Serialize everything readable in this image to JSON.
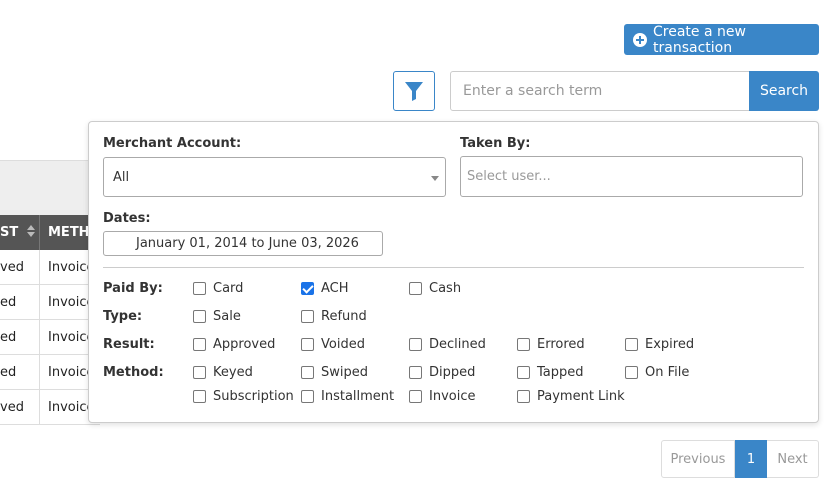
{
  "header": {
    "create_label": "Create a new transaction",
    "search_placeholder": "Enter a search term",
    "search_label": "Search"
  },
  "table": {
    "columns": [
      "ST",
      "METHO"
    ],
    "rows": [
      [
        "ved",
        "Invoice"
      ],
      [
        "ed",
        "Invoice"
      ],
      [
        "ed",
        "Invoice"
      ],
      [
        "ed",
        "Invoice"
      ],
      [
        "ved",
        "Invoice"
      ]
    ]
  },
  "filters": {
    "merchant_label": "Merchant Account:",
    "merchant_value": "All",
    "taken_by_label": "Taken By:",
    "taken_by_placeholder": "Select user...",
    "dates_label": "Dates:",
    "dates_value": "January 01, 2014 to June 03, 2026",
    "paid_by": {
      "label": "Paid By:",
      "options": [
        {
          "label": "Card",
          "checked": false
        },
        {
          "label": "ACH",
          "checked": true
        },
        {
          "label": "Cash",
          "checked": false
        }
      ]
    },
    "type": {
      "label": "Type:",
      "options": [
        {
          "label": "Sale",
          "checked": false
        },
        {
          "label": "Refund",
          "checked": false
        }
      ]
    },
    "result": {
      "label": "Result:",
      "options": [
        {
          "label": "Approved",
          "checked": false
        },
        {
          "label": "Voided",
          "checked": false
        },
        {
          "label": "Declined",
          "checked": false
        },
        {
          "label": "Errored",
          "checked": false
        },
        {
          "label": "Expired",
          "checked": false
        }
      ]
    },
    "method": {
      "label": "Method:",
      "options": [
        {
          "label": "Keyed",
          "checked": false
        },
        {
          "label": "Swiped",
          "checked": false
        },
        {
          "label": "Dipped",
          "checked": false
        },
        {
          "label": "Tapped",
          "checked": false
        },
        {
          "label": "On File",
          "checked": false
        },
        {
          "label": "Subscription",
          "checked": false
        },
        {
          "label": "Installment",
          "checked": false
        },
        {
          "label": "Invoice",
          "checked": false
        },
        {
          "label": "Payment Link",
          "checked": false
        }
      ]
    }
  },
  "pagination": {
    "previous": "Previous",
    "current": "1",
    "next": "Next"
  },
  "colors": {
    "primary": "#3a86c8",
    "checkbox_checked": "#1a73e8",
    "table_header": "#555555"
  },
  "icons": {
    "create": "plus-circle-icon",
    "filter": "filter-icon",
    "sort": "sort-icon",
    "dropdown": "caret-down-icon"
  }
}
